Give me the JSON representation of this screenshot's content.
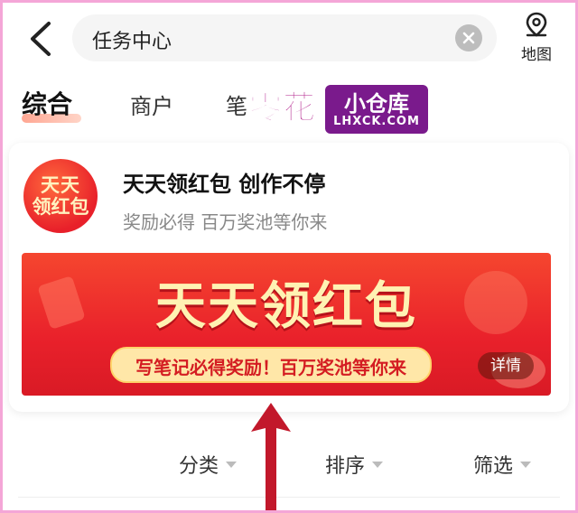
{
  "search": {
    "query": "任务中心"
  },
  "map_button": {
    "label": "地图"
  },
  "tabs": [
    {
      "label": "综合",
      "active": true
    },
    {
      "label": "商户",
      "active": false
    },
    {
      "label": "笔",
      "active": false
    }
  ],
  "watermark": {
    "text_left": "零花",
    "text_right_top": "小仓库",
    "text_right_bottom": "LHXCK.COM"
  },
  "card": {
    "logo_line1": "天天",
    "logo_line2": "领红包",
    "title": "天天领红包 创作不停",
    "subtitle": "奖励必得 百万奖池等你来",
    "banner_title": "天天领红包",
    "banner_pill": "写笔记必得奖励！百万奖池等你来",
    "detail_button": "详情"
  },
  "filters": [
    {
      "label": "分类"
    },
    {
      "label": "排序"
    },
    {
      "label": "筛选"
    }
  ],
  "colors": {
    "accent": "#e9212b",
    "watermark": "#7a1a8c",
    "arrow": "#c2182b"
  }
}
